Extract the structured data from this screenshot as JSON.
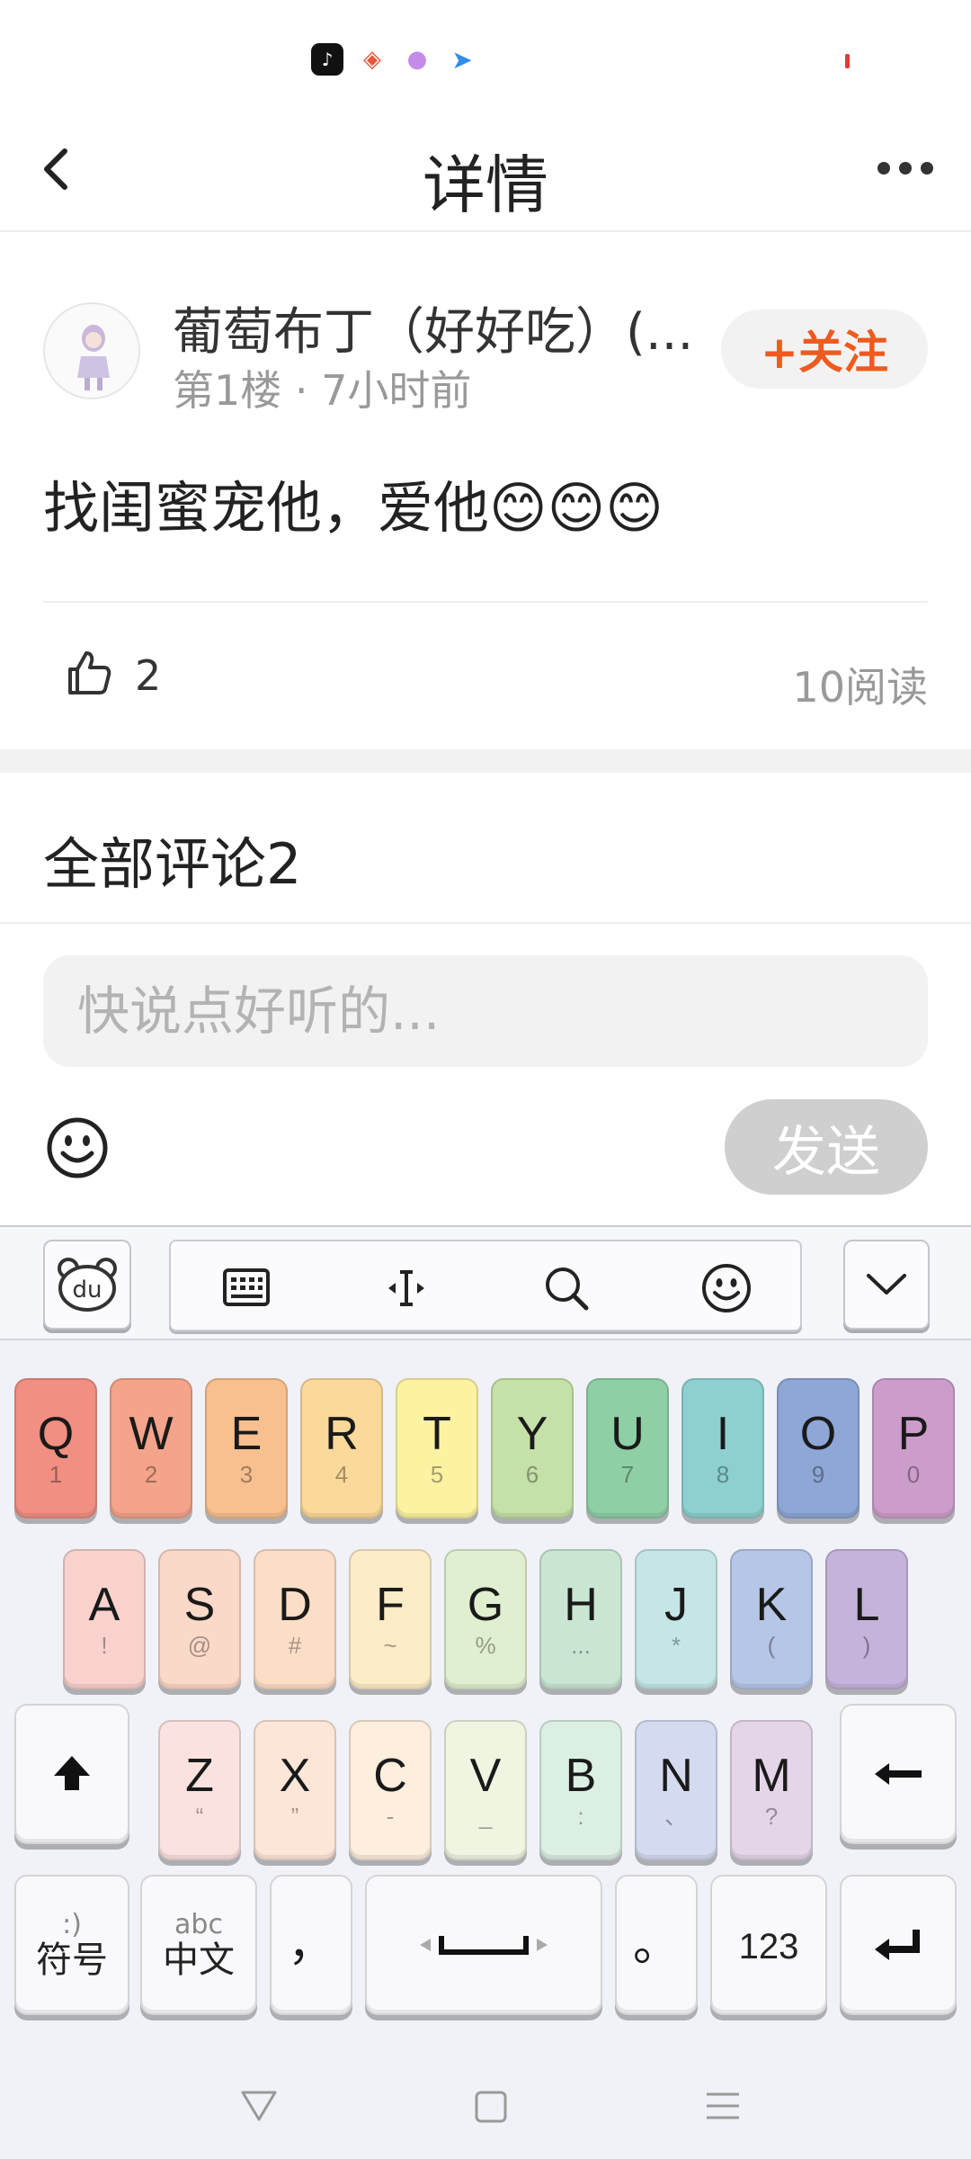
{
  "status_bar": {
    "icons": [
      "tiktok-icon",
      "game-icon",
      "ball-icon",
      "paper-plane-icon"
    ]
  },
  "header": {
    "title": "详情",
    "back_icon": "chevron-left-icon",
    "more_icon": "more-dots-icon"
  },
  "post": {
    "author_name": "葡萄布丁（好好吃）(...",
    "meta": "第1楼 · 7小时前",
    "follow_label": "+关注",
    "content": "找闺蜜宠他，爱他😊😊😊",
    "like_count": "2",
    "read_count": "10阅读"
  },
  "comments": {
    "title": "全部评论2",
    "input_placeholder": "快说点好听的...",
    "send_label": "发送"
  },
  "keyboard": {
    "toolbar_icons": [
      "du-logo-icon",
      "keyboard-icon",
      "cursor-icon",
      "search-icon",
      "emoji-icon",
      "chevron-down-icon"
    ],
    "du_label": "du",
    "row1": [
      {
        "main": "Q",
        "sub": "1",
        "color": "#f08f82"
      },
      {
        "main": "W",
        "sub": "2",
        "color": "#f4a48a"
      },
      {
        "main": "E",
        "sub": "3",
        "color": "#f7c08e"
      },
      {
        "main": "R",
        "sub": "4",
        "color": "#fbd99a"
      },
      {
        "main": "T",
        "sub": "5",
        "color": "#fdf2a2"
      },
      {
        "main": "Y",
        "sub": "6",
        "color": "#c6e1a8"
      },
      {
        "main": "U",
        "sub": "7",
        "color": "#8fcfa6"
      },
      {
        "main": "I",
        "sub": "8",
        "color": "#8ed0d0"
      },
      {
        "main": "O",
        "sub": "9",
        "color": "#8ea7d6"
      },
      {
        "main": "P",
        "sub": "0",
        "color": "#cc9dca"
      }
    ],
    "row2": [
      {
        "main": "A",
        "sub": "!",
        "color": "#f9d2cd"
      },
      {
        "main": "S",
        "sub": "@",
        "color": "#fbd9c8"
      },
      {
        "main": "D",
        "sub": "#",
        "color": "#fcdec7"
      },
      {
        "main": "F",
        "sub": "~",
        "color": "#fdecc8"
      },
      {
        "main": "G",
        "sub": "%",
        "color": "#e0efcf"
      },
      {
        "main": "H",
        "sub": "...",
        "color": "#c9e6d3"
      },
      {
        "main": "J",
        "sub": "*",
        "color": "#c5e6e6"
      },
      {
        "main": "K",
        "sub": "(",
        "color": "#b6c6e6"
      },
      {
        "main": "L",
        "sub": ")",
        "color": "#c6b3db"
      }
    ],
    "row3": [
      {
        "main": "Z",
        "sub": "“",
        "color": "#fbe2de"
      },
      {
        "main": "X",
        "sub": "”",
        "color": "#fde6d8"
      },
      {
        "main": "C",
        "sub": "-",
        "color": "#fdeede"
      },
      {
        "main": "V",
        "sub": "_",
        "color": "#eef6e2"
      },
      {
        "main": "B",
        "sub": ":",
        "color": "#dcefe3"
      },
      {
        "main": "N",
        "sub": "、",
        "color": "#d4dbf0"
      },
      {
        "main": "M",
        "sub": "?",
        "color": "#e4d6e8"
      }
    ],
    "shift_icon": "shift-arrow-icon",
    "backspace_icon": "backspace-arrow-icon",
    "symbol_key": {
      "small": ":)",
      "label": "符号"
    },
    "lang_key": {
      "small": "abc",
      "label": "中文"
    },
    "comma_key": "，",
    "period_key": "。",
    "number_key": "123",
    "enter_icon": "enter-icon"
  },
  "nav_bar": {
    "icons": [
      "triangle-back-icon",
      "square-home-icon",
      "menu-lines-icon"
    ]
  }
}
